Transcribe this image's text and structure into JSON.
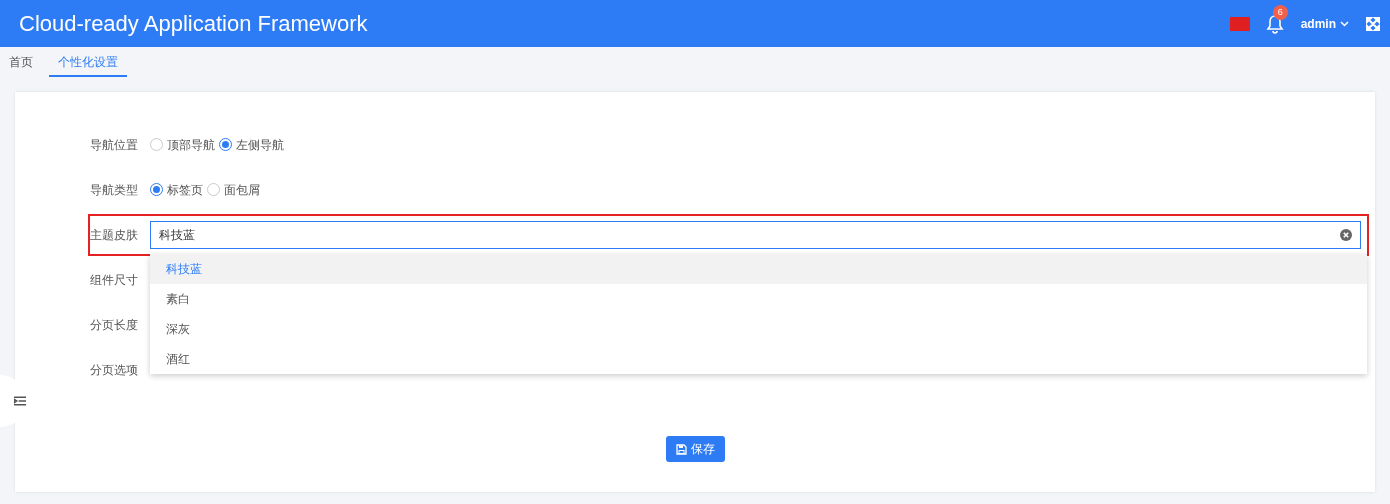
{
  "header": {
    "title": "Cloud-ready Application Framework",
    "notification_count": "6",
    "user": "admin"
  },
  "tabs": [
    {
      "label": "首页",
      "selected": false
    },
    {
      "label": "个性化设置",
      "selected": true
    }
  ],
  "form": {
    "rows": [
      {
        "label": "导航位置",
        "kind": "radio",
        "highlighted": false,
        "options": [
          {
            "label": "顶部导航",
            "selected": false
          },
          {
            "label": "左侧导航",
            "selected": true
          }
        ]
      },
      {
        "label": "导航类型",
        "kind": "radio",
        "highlighted": false,
        "options": [
          {
            "label": "标签页",
            "selected": true
          },
          {
            "label": "面包屑",
            "selected": false
          }
        ]
      },
      {
        "label": "主题皮肤",
        "kind": "select",
        "highlighted": true,
        "value": "科技蓝",
        "expanded": true,
        "options": [
          {
            "label": "科技蓝",
            "selected": true
          },
          {
            "label": "素白",
            "selected": false
          },
          {
            "label": "深灰",
            "selected": false
          },
          {
            "label": "酒红",
            "selected": false
          }
        ]
      },
      {
        "label": "组件尺寸",
        "kind": "hidden",
        "highlighted": false
      },
      {
        "label": "分页长度",
        "kind": "hidden",
        "highlighted": false
      },
      {
        "label": "分页选项",
        "kind": "hidden",
        "highlighted": false
      }
    ],
    "save_button": "保存"
  }
}
